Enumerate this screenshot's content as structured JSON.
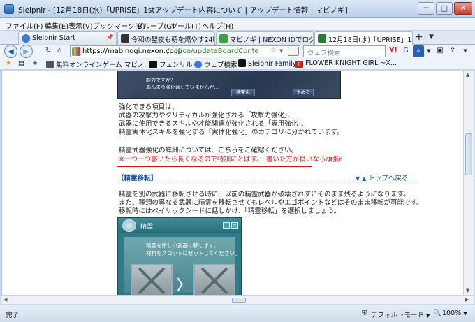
{
  "window": {
    "title": "Sleipnir - [12月18日(水)「UPRISE」1stアップデート内容について | アップデート情報 | マビノギ]",
    "controls": {
      "minimize": "─",
      "maximize": "□",
      "close": "✕"
    }
  },
  "menu": [
    "ファイル(F)",
    "編集(E)",
    "表示(V)",
    "ブックマーク(B)",
    "グループ(G)",
    "ツール(T)",
    "ヘルプ(H)"
  ],
  "tabs": [
    {
      "label": "Sleipnir Start",
      "icon_color": "#3b7bd6",
      "pin": "📌"
    },
    {
      "label": "令和の聖夜も萌を燃やす24時...",
      "icon_color": "#333333"
    },
    {
      "label": "マビノギ | NEXON IDでログ...",
      "icon_color": "#3aa23a"
    },
    {
      "label": "12月18日(水)「UPRISE」1st...",
      "icon_color": "#2a7a3a",
      "active": true
    }
  ],
  "tab_add": "+",
  "tab_menu": "▼",
  "nav": {
    "back": "◀",
    "forward": "▶",
    "reload_icon": "↻",
    "home_icon": "⌂",
    "url_host": "https://mabinogi.nexon.co.jp",
    "url_path": "/notice/updateBoardContent.as",
    "search_placeholder": "ウェブ検索",
    "star_icon": "☆",
    "dropdown": "▼"
  },
  "bookmarks": [
    {
      "label": "無料オンラインゲーム マビノ...",
      "icon_color": "#555555"
    },
    {
      "label": "フェンリル",
      "icon_color": "#111111"
    },
    {
      "label": "ウェブ検索",
      "icon_color": "#3b7bd6"
    },
    {
      "label": "Sleipnir Family",
      "icon_color": "#111111"
    },
    {
      "label": "FLOWER KNIGHT GIRL ~X...",
      "icon_color": "#cc1f1f"
    }
  ],
  "game_top": {
    "prompt_line1": "能力ですか？",
    "prompt_line2": "あんまり強化はしていませんが...",
    "button1": "精霊化",
    "button2": "やめる"
  },
  "content": {
    "para1": [
      "強化できる項目は、",
      "武器の攻撃力やクリティカルが強化される「攻撃力強化」、",
      "武器に使用できるスキルや才能関連が強化される「専用強化」、",
      "精霊実体化スキルを強化する「実体化強化」のカテゴリに分かれています。"
    ],
    "para2": "精霊武器強化の詳細については、こちらをご確認ください。",
    "red_note": "※一つ一つ書いたら長くなるので特訓にとばす。···書いた方が良いなら頑張r",
    "section_title": "【精霊移転】",
    "top_link": "トップへ戻る",
    "para3": [
      "精霊を別の武器に移転させる時に、以前の精霊武器が破壊されずにそのまま残るようになります。",
      "また、種類の異なる武器に精霊を移転させてもレベルやエゴポイントなどはそのまま移転が可能です。",
      "移転時にはペイリックシードに話しかけ、「精霊移転」を選択しましょう。"
    ]
  },
  "game_dialog": {
    "title": "精霊",
    "message_line1": "精霊を新しい武器に移します。",
    "message_line2": "材料をスロットにセットしてください。",
    "arrow": "〉"
  },
  "status": {
    "left": "完了",
    "mode": "デフォルトモード",
    "zoom": "100%",
    "mode_dropdown": "▼",
    "zoom_dropdown": "▼"
  },
  "colors": {
    "accent_link": "#1a4fa0",
    "red_note": "#d01c1c",
    "url_path": "#2a8a2a"
  }
}
